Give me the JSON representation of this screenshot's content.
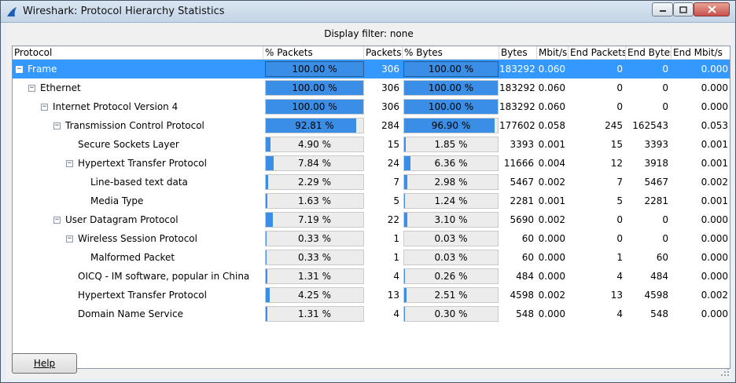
{
  "window": {
    "title": "Wireshark: Protocol Hierarchy Statistics",
    "controls": {
      "minimize": "▭",
      "maximize": "□",
      "close": "✕"
    }
  },
  "filter_text": "Display filter: none",
  "columns": [
    "Protocol",
    "% Packets",
    "Packets",
    "% Bytes",
    "Bytes",
    "Mbit/s",
    "End Packets",
    "End Bytes",
    "End Mbit/s"
  ],
  "rows": [
    {
      "level": 0,
      "expander": "minus",
      "protocol": "Frame",
      "pct_packets": "100.00 %",
      "pct_packets_val": 100.0,
      "packets": "306",
      "pct_bytes": "100.00 %",
      "pct_bytes_val": 100.0,
      "bytes": "183292",
      "mbit": "0.060",
      "end_packets": "0",
      "end_bytes": "0",
      "end_mbit": "0.000",
      "selected": true
    },
    {
      "level": 1,
      "expander": "minus",
      "protocol": "Ethernet",
      "pct_packets": "100.00 %",
      "pct_packets_val": 100.0,
      "packets": "306",
      "pct_bytes": "100.00 %",
      "pct_bytes_val": 100.0,
      "bytes": "183292",
      "mbit": "0.060",
      "end_packets": "0",
      "end_bytes": "0",
      "end_mbit": "0.000"
    },
    {
      "level": 2,
      "expander": "minus",
      "protocol": "Internet Protocol Version 4",
      "pct_packets": "100.00 %",
      "pct_packets_val": 100.0,
      "packets": "306",
      "pct_bytes": "100.00 %",
      "pct_bytes_val": 100.0,
      "bytes": "183292",
      "mbit": "0.060",
      "end_packets": "0",
      "end_bytes": "0",
      "end_mbit": "0.000"
    },
    {
      "level": 3,
      "expander": "minus",
      "protocol": "Transmission Control Protocol",
      "pct_packets": "92.81 %",
      "pct_packets_val": 92.81,
      "packets": "284",
      "pct_bytes": "96.90 %",
      "pct_bytes_val": 96.9,
      "bytes": "177602",
      "mbit": "0.058",
      "end_packets": "245",
      "end_bytes": "162543",
      "end_mbit": "0.053"
    },
    {
      "level": 4,
      "expander": "none",
      "protocol": "Secure Sockets Layer",
      "pct_packets": "4.90 %",
      "pct_packets_val": 4.9,
      "packets": "15",
      "pct_bytes": "1.85 %",
      "pct_bytes_val": 1.85,
      "bytes": "3393",
      "mbit": "0.001",
      "end_packets": "15",
      "end_bytes": "3393",
      "end_mbit": "0.001"
    },
    {
      "level": 4,
      "expander": "minus",
      "protocol": "Hypertext Transfer Protocol",
      "pct_packets": "7.84 %",
      "pct_packets_val": 7.84,
      "packets": "24",
      "pct_bytes": "6.36 %",
      "pct_bytes_val": 6.36,
      "bytes": "11666",
      "mbit": "0.004",
      "end_packets": "12",
      "end_bytes": "3918",
      "end_mbit": "0.001"
    },
    {
      "level": 5,
      "expander": "none",
      "protocol": "Line-based text data",
      "pct_packets": "2.29 %",
      "pct_packets_val": 2.29,
      "packets": "7",
      "pct_bytes": "2.98 %",
      "pct_bytes_val": 2.98,
      "bytes": "5467",
      "mbit": "0.002",
      "end_packets": "7",
      "end_bytes": "5467",
      "end_mbit": "0.002"
    },
    {
      "level": 5,
      "expander": "none",
      "protocol": "Media Type",
      "pct_packets": "1.63 %",
      "pct_packets_val": 1.63,
      "packets": "5",
      "pct_bytes": "1.24 %",
      "pct_bytes_val": 1.24,
      "bytes": "2281",
      "mbit": "0.001",
      "end_packets": "5",
      "end_bytes": "2281",
      "end_mbit": "0.001"
    },
    {
      "level": 3,
      "expander": "minus",
      "protocol": "User Datagram Protocol",
      "pct_packets": "7.19 %",
      "pct_packets_val": 7.19,
      "packets": "22",
      "pct_bytes": "3.10 %",
      "pct_bytes_val": 3.1,
      "bytes": "5690",
      "mbit": "0.002",
      "end_packets": "0",
      "end_bytes": "0",
      "end_mbit": "0.000"
    },
    {
      "level": 4,
      "expander": "minus",
      "protocol": "Wireless Session Protocol",
      "pct_packets": "0.33 %",
      "pct_packets_val": 0.33,
      "packets": "1",
      "pct_bytes": "0.03 %",
      "pct_bytes_val": 0.03,
      "bytes": "60",
      "mbit": "0.000",
      "end_packets": "0",
      "end_bytes": "0",
      "end_mbit": "0.000"
    },
    {
      "level": 5,
      "expander": "none",
      "protocol": "Malformed Packet",
      "pct_packets": "0.33 %",
      "pct_packets_val": 0.33,
      "packets": "1",
      "pct_bytes": "0.03 %",
      "pct_bytes_val": 0.03,
      "bytes": "60",
      "mbit": "0.000",
      "end_packets": "1",
      "end_bytes": "60",
      "end_mbit": "0.000"
    },
    {
      "level": 4,
      "expander": "none",
      "protocol": "OICQ - IM software, popular in China",
      "pct_packets": "1.31 %",
      "pct_packets_val": 1.31,
      "packets": "4",
      "pct_bytes": "0.26 %",
      "pct_bytes_val": 0.26,
      "bytes": "484",
      "mbit": "0.000",
      "end_packets": "4",
      "end_bytes": "484",
      "end_mbit": "0.000"
    },
    {
      "level": 4,
      "expander": "none",
      "protocol": "Hypertext Transfer Protocol",
      "pct_packets": "4.25 %",
      "pct_packets_val": 4.25,
      "packets": "13",
      "pct_bytes": "2.51 %",
      "pct_bytes_val": 2.51,
      "bytes": "4598",
      "mbit": "0.002",
      "end_packets": "13",
      "end_bytes": "4598",
      "end_mbit": "0.002"
    },
    {
      "level": 4,
      "expander": "none",
      "protocol": "Domain Name Service",
      "pct_packets": "1.31 %",
      "pct_packets_val": 1.31,
      "packets": "4",
      "pct_bytes": "0.30 %",
      "pct_bytes_val": 0.3,
      "bytes": "548",
      "mbit": "0.000",
      "end_packets": "4",
      "end_bytes": "548",
      "end_mbit": "0.000"
    }
  ],
  "help_button": {
    "label": "Help"
  },
  "colors": {
    "selection": "#3399ff",
    "bar_fill": "#3a8ee6",
    "bar_bg": "#ececec"
  },
  "icons": {
    "app": "wireshark-fin-icon",
    "expander": "tree-expander-icon",
    "grip": "resize-grip-icon"
  }
}
